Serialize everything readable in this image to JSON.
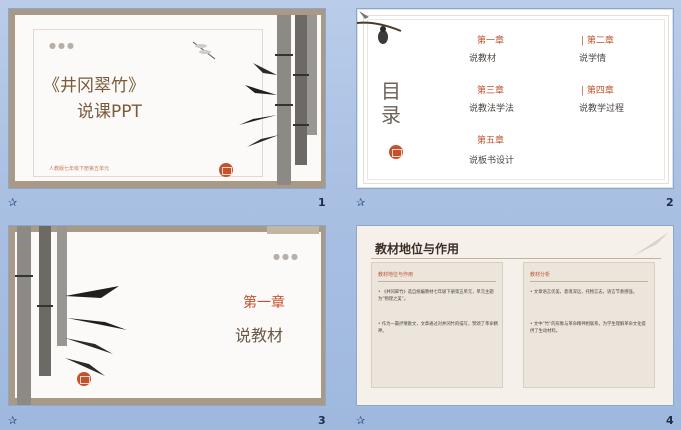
{
  "slides": [
    {
      "number": "1",
      "title": "《井冈翠竹》",
      "subtitle": "说课PPT",
      "caption": "人教版七年级下册第五单元"
    },
    {
      "number": "2",
      "heading": "目录",
      "chapters": [
        {
          "chapter": "第一章",
          "label": "说教材"
        },
        {
          "chapter": "第二章",
          "label": "说学情"
        },
        {
          "chapter": "第三章",
          "label": "说教法学法"
        },
        {
          "chapter": "第四章",
          "label": "说教学过程"
        },
        {
          "chapter": "第五章",
          "label": "说板书设计"
        }
      ]
    },
    {
      "number": "3",
      "chapter": "第一章",
      "title": "说教材"
    },
    {
      "number": "4",
      "heading": "教材地位与作用",
      "left_title": "教材地位与作用",
      "left_bullets": [
        "《井冈翠竹》选自统编教材七年级下册第五单元，单元主题为“物理之美”。",
        "作为一篇抒情散文，文章通过对井冈竹的描写，赞颂了革命精神。"
      ],
      "right_title": "教材分析",
      "right_bullets": [
        "文章语言优美，意境深远，托物言志，语言节奏感强。",
        "文中“竹”的形象与革命精神相联系，为学生理解革命文化提供了生动材料。"
      ]
    }
  ],
  "star_glyph": "✰"
}
